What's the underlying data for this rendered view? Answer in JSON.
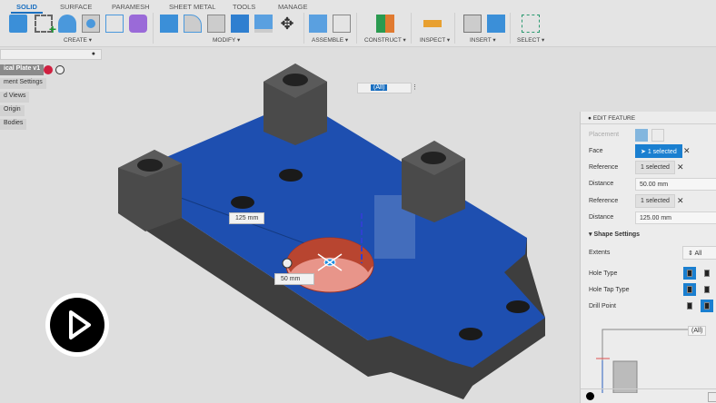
{
  "toolbar": {
    "tabs": [
      "SOLID",
      "SURFACE",
      "PARAMESH",
      "SHEET METAL",
      "TOOLS",
      "MANAGE"
    ],
    "active_tab": "SOLID",
    "groups": [
      "CREATE ▾",
      "MODIFY ▾",
      "ASSEMBLE ▾",
      "CONSTRUCT ▾",
      "INSPECT ▾",
      "INSERT ▾",
      "SELECT ▾"
    ]
  },
  "browser": {
    "items": [
      "ical Plate v1",
      "ment Settings",
      "d Views",
      "Origin",
      "Bodies"
    ]
  },
  "viewport": {
    "filter": "(All)",
    "dim1": "125 mm",
    "dim2": "50 mm"
  },
  "panel": {
    "title": "EDIT FEATURE",
    "placement": "Placement",
    "face_label": "Face",
    "face_value": "1 selected",
    "ref1_label": "Reference",
    "ref1_value": "1 selected",
    "dist1_label": "Distance",
    "dist1_value": "50.00 mm",
    "ref2_label": "Reference",
    "ref2_value": "1 selected",
    "dist2_label": "Distance",
    "dist2_value": "125.00 mm",
    "shape_settings": "Shape Settings",
    "extents_label": "Extents",
    "extents_value": "All",
    "hole_type": "Hole Type",
    "hole_tap_type": "Hole Tap Type",
    "drill_point": "Drill Point",
    "diagram_label": "(All)"
  },
  "colors": {
    "accent": "#1a7fd0",
    "plate": "#1e4fb0",
    "hole": "#e06a5a"
  }
}
